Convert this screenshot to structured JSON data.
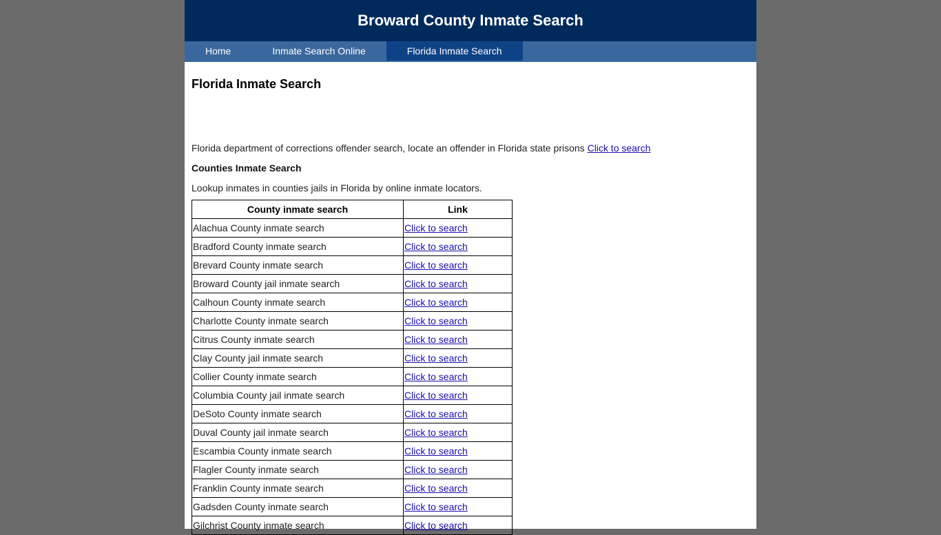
{
  "header": {
    "title": "Broward County Inmate Search"
  },
  "nav": {
    "items": [
      {
        "label": "Home"
      },
      {
        "label": "Inmate Search Online"
      },
      {
        "label": "Florida Inmate Search",
        "active": true
      }
    ]
  },
  "main": {
    "title": "Florida Inmate Search",
    "intro": "Florida department of corrections offender search, locate an offender in Florida state prisons ",
    "intro_link": "Click to search",
    "subheading": "Counties Inmate Search",
    "lookup_text": "Lookup inmates in counties jails in Florida by online inmate locators.",
    "table": {
      "headers": [
        "County inmate search",
        "Link"
      ],
      "rows": [
        {
          "name": "Alachua County inmate search",
          "link": "Click to search"
        },
        {
          "name": "Bradford County inmate search",
          "link": "Click to search"
        },
        {
          "name": "Brevard County inmate search",
          "link": "Click to search"
        },
        {
          "name": "Broward County jail inmate search",
          "link": "Click to search"
        },
        {
          "name": "Calhoun County inmate search",
          "link": "Click to search"
        },
        {
          "name": "Charlotte County inmate search",
          "link": "Click to search"
        },
        {
          "name": "Citrus County inmate search",
          "link": "Click to search"
        },
        {
          "name": "Clay County jail inmate search",
          "link": "Click to search"
        },
        {
          "name": "Collier County inmate search",
          "link": "Click to search"
        },
        {
          "name": "Columbia County jail inmate search",
          "link": "Click to search"
        },
        {
          "name": "DeSoto County inmate search",
          "link": "Click to search"
        },
        {
          "name": "Duval County jail inmate search",
          "link": "Click to search"
        },
        {
          "name": "Escambia County inmate search",
          "link": "Click to search"
        },
        {
          "name": "Flagler County inmate search",
          "link": "Click to search"
        },
        {
          "name": "Franklin County inmate search",
          "link": "Click to search"
        },
        {
          "name": "Gadsden County inmate search",
          "link": "Click to search"
        },
        {
          "name": "Gilchrist County inmate search",
          "link": "Click to search"
        }
      ]
    }
  }
}
